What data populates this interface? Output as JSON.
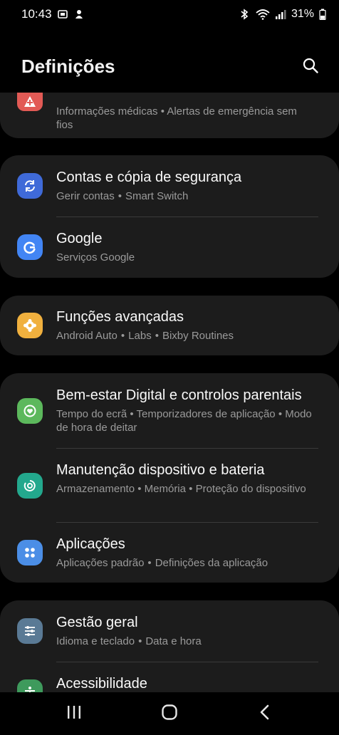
{
  "status_bar": {
    "time": "10:43",
    "battery_percent": "31%",
    "icons_left": [
      "sim-card-icon",
      "notification-icon"
    ],
    "icons_right": [
      "bluetooth-icon",
      "wifi-icon",
      "signal-icon",
      "battery-icon"
    ]
  },
  "header": {
    "title": "Definições",
    "search_icon": "search-icon"
  },
  "colors": {
    "background": "#000000",
    "card": "#1c1c1c",
    "subtitle": "#9a9a9a",
    "safety_icon": "#e25a55",
    "accounts_icon": "#3f6ad8",
    "google_icon": "#4285f4",
    "advanced_icon": "#f0b03e",
    "wellbeing_icon": "#5cb85c",
    "maintenance_icon": "#23a88d",
    "apps_icon": "#4b8ee6",
    "general_icon": "#5a7a95",
    "accessibility_icon": "#3e9a5c"
  },
  "settings": {
    "safety": {
      "subtitle": "Informações médicas • Alertas de emergência sem fios",
      "icon": "medical-icon"
    },
    "accounts": {
      "title": "Contas e cópia de segurança",
      "subtitle_parts": [
        "Gerir contas",
        "Smart Switch"
      ],
      "icon": "sync-icon"
    },
    "google": {
      "title": "Google",
      "subtitle": "Serviços Google",
      "icon": "google-icon"
    },
    "advanced": {
      "title": "Funções avançadas",
      "subtitle_parts": [
        "Android Auto",
        "Labs",
        "Bixby Routines"
      ],
      "icon": "star-gear-icon"
    },
    "wellbeing": {
      "title": "Bem-estar Digital e controlos parentais",
      "subtitle": "Tempo do ecrã • Temporizadores de aplicação • Modo de hora de deitar",
      "icon": "heart-circle-icon"
    },
    "maintenance": {
      "title": "Manutenção dispositivo e bateria",
      "subtitle": "Armazenamento • Memória • Proteção do dispositivo",
      "icon": "device-care-icon"
    },
    "apps": {
      "title": "Aplicações",
      "subtitle_parts": [
        "Aplicações padrão",
        "Definições da aplicação"
      ],
      "icon": "apps-grid-icon"
    },
    "general": {
      "title": "Gestão geral",
      "subtitle_parts": [
        "Idioma e teclado",
        "Data e hora"
      ],
      "icon": "sliders-icon"
    },
    "accessibility": {
      "title": "Acessibilidade",
      "icon": "accessibility-icon"
    }
  },
  "nav_bar": {
    "recents_icon": "recents-icon",
    "home_icon": "home-icon",
    "back_icon": "back-icon"
  }
}
